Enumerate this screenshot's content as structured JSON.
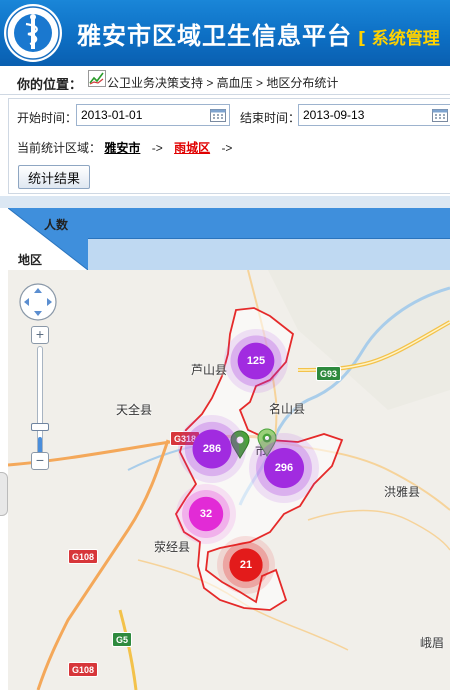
{
  "header": {
    "title": "雅安市区域卫生信息平台",
    "subtitle": "[ 系统管理",
    "logo": "health-org-emblem",
    "brand_color": "#0d6fc4",
    "subtitle_color": "#ffd200"
  },
  "breadcrumb": {
    "label": "你的位置：",
    "icon": "chart-icon",
    "path": "公卫业务决策支持 > 高血压 > 地区分布统计"
  },
  "filter": {
    "start_label": "开始时间：",
    "start_value": "2013-01-01",
    "end_label": "结束时间：",
    "end_value": "2013-09-13",
    "region_label": "当前统计区域：",
    "region_city": "雅安市",
    "region_sep": "->",
    "region_district": "雨城区",
    "region_tail": "->",
    "submit_label": "统计结果"
  },
  "table": {
    "header_top": "人数",
    "header_bottom": "地区",
    "header_color": "#3f8fdc",
    "subheader_color": "#bfd9f2"
  },
  "map": {
    "places": {
      "lushan": "芦山县",
      "tianquan": "天全县",
      "mingshan": "名山县",
      "hongya": "洪雅县",
      "yingjing": "荥经县",
      "ebian": "峨眉",
      "yacity": "市"
    },
    "roads": {
      "g93": "G93",
      "g318": "G318",
      "g108a": "G108",
      "g5": "G5",
      "g108b": "G108"
    },
    "clusters": [
      {
        "count": "125",
        "color": "#a12be0"
      },
      {
        "count": "286",
        "color": "#a12be0"
      },
      {
        "count": "296",
        "color": "#a12be0"
      },
      {
        "count": "32",
        "color": "#e22bd6"
      },
      {
        "count": "21",
        "color": "#e31b1b"
      }
    ],
    "boundary_color": "#e52a2a",
    "zoom_level": 0.22
  }
}
